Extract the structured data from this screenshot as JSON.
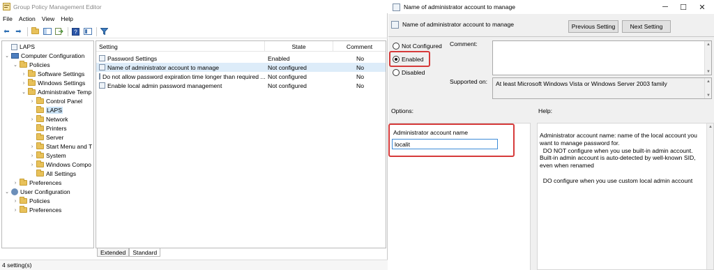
{
  "gpme": {
    "title": "Group Policy Management Editor",
    "menu": [
      "File",
      "Action",
      "View",
      "Help"
    ],
    "tree": [
      {
        "label": "LAPS",
        "depth": 0,
        "icon": "document-icon",
        "chev": ""
      },
      {
        "label": "Computer Configuration",
        "depth": 0,
        "icon": "computer-icon",
        "chev": "⌄"
      },
      {
        "label": "Policies",
        "depth": 1,
        "icon": "folder-icon",
        "chev": "⌄"
      },
      {
        "label": "Software Settings",
        "depth": 2,
        "icon": "folder-icon",
        "chev": "›"
      },
      {
        "label": "Windows Settings",
        "depth": 2,
        "icon": "folder-icon",
        "chev": "›"
      },
      {
        "label": "Administrative Temp",
        "depth": 2,
        "icon": "folder-icon",
        "chev": "⌄"
      },
      {
        "label": "Control Panel",
        "depth": 3,
        "icon": "folder-icon",
        "chev": "›"
      },
      {
        "label": "LAPS",
        "depth": 3,
        "icon": "folder-icon",
        "chev": "",
        "selected": true
      },
      {
        "label": "Network",
        "depth": 3,
        "icon": "folder-icon",
        "chev": "›"
      },
      {
        "label": "Printers",
        "depth": 3,
        "icon": "folder-icon",
        "chev": ""
      },
      {
        "label": "Server",
        "depth": 3,
        "icon": "folder-icon",
        "chev": ""
      },
      {
        "label": "Start Menu and T",
        "depth": 3,
        "icon": "folder-icon",
        "chev": "›"
      },
      {
        "label": "System",
        "depth": 3,
        "icon": "folder-icon",
        "chev": "›"
      },
      {
        "label": "Windows Compo",
        "depth": 3,
        "icon": "folder-icon",
        "chev": "›"
      },
      {
        "label": "All Settings",
        "depth": 3,
        "icon": "folder-icon",
        "chev": ""
      },
      {
        "label": "Preferences",
        "depth": 1,
        "icon": "folder-icon",
        "chev": "›"
      },
      {
        "label": "User Configuration",
        "depth": 0,
        "icon": "user-icon",
        "chev": "⌄"
      },
      {
        "label": "Policies",
        "depth": 1,
        "icon": "folder-icon",
        "chev": "›"
      },
      {
        "label": "Preferences",
        "depth": 1,
        "icon": "folder-icon",
        "chev": "›"
      }
    ],
    "columns": {
      "setting": "Setting",
      "state": "State",
      "comment": "Comment"
    },
    "rows": [
      {
        "setting": "Password Settings",
        "state": "Enabled",
        "comment": "No"
      },
      {
        "setting": "Name of administrator account to manage",
        "state": "Not configured",
        "comment": "No",
        "selected": true
      },
      {
        "setting": "Do not allow password expiration time longer than required ...",
        "state": "Not configured",
        "comment": "No"
      },
      {
        "setting": "Enable local admin password management",
        "state": "Not configured",
        "comment": "No"
      }
    ],
    "tabs": [
      "Extended",
      "Standard"
    ],
    "status": "4 setting(s)"
  },
  "dialog": {
    "title": "Name of administrator account to manage",
    "header": "Name of administrator account to manage",
    "prev_button": "Previous Setting",
    "next_button": "Next Setting",
    "radio_not_configured": "Not Configured",
    "radio_enabled": "Enabled",
    "radio_disabled": "Disabled",
    "comment_label": "Comment:",
    "supported_label": "Supported on:",
    "supported_value": "At least Microsoft Windows Vista or Windows Server 2003 family",
    "options_label": "Options:",
    "help_label": "Help:",
    "admin_field_label": "Administrator account name",
    "admin_field_value": "localit",
    "help_text": "Administrator account name: name of the local account you want to manage password for.\n  DO NOT configure when you use built-in admin account. Built-in admin account is auto-detected by well-known SID, even when renamed\n\n  DO configure when you use custom local admin account"
  },
  "colors": {
    "highlight": "#d63a3a",
    "selection": "#cce4f7"
  }
}
